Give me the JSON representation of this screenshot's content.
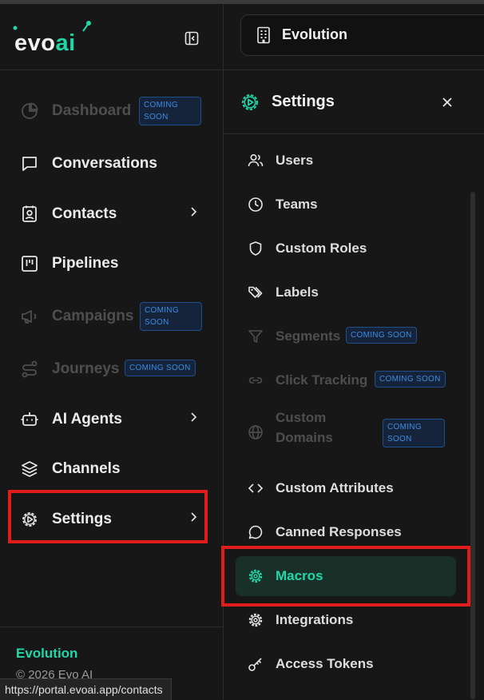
{
  "app": {
    "logo_evo": "evo",
    "logo_ai": "ai",
    "workspace_name": "Evolution",
    "brand_color": "#21d7a8"
  },
  "sidebar": {
    "items": [
      {
        "label": "Dashboard",
        "badge": "COMING SOON",
        "disabled": true
      },
      {
        "label": "Conversations"
      },
      {
        "label": "Contacts",
        "has_chevron": true
      },
      {
        "label": "Pipelines"
      },
      {
        "label": "Campaigns",
        "badge": "COMING SOON",
        "disabled": true
      },
      {
        "label": "Journeys",
        "badge": "COMING SOON",
        "disabled": true
      },
      {
        "label": "AI Agents",
        "has_chevron": true
      },
      {
        "label": "Channels"
      },
      {
        "label": "Settings",
        "has_chevron": true,
        "highlighted": true
      }
    ],
    "footer_brand": "Evolution",
    "footer_copy": "© 2026 Evo AI"
  },
  "settings_panel": {
    "title": "Settings",
    "items": [
      {
        "label": "Users"
      },
      {
        "label": "Teams"
      },
      {
        "label": "Custom Roles"
      },
      {
        "label": "Labels"
      },
      {
        "label": "Segments",
        "badge": "COMING SOON",
        "disabled": true
      },
      {
        "label": "Click Tracking",
        "badge": "COMING SOON",
        "disabled": true
      },
      {
        "label": "Custom Domains",
        "line1": "Custom",
        "line2": "Domains",
        "badge_line1": "COMING",
        "badge_line2": "SOON",
        "disabled": true
      },
      {
        "label": "Custom Attributes"
      },
      {
        "label": "Canned Responses"
      },
      {
        "label": "Macros",
        "active": true
      },
      {
        "label": "Integrations"
      },
      {
        "label": "Access Tokens"
      }
    ]
  },
  "badges": {
    "coming": "COMING",
    "soon": "SOON",
    "coming_soon": "COMING SOON"
  },
  "status_bar": {
    "url": "https://portal.evoai.app/contacts"
  },
  "colors": {
    "background": "#171717",
    "highlight_box": "#e21b1b",
    "active_bg": "#193028",
    "badge_border": "#1f4f8c",
    "badge_text": "#3f8be0"
  }
}
